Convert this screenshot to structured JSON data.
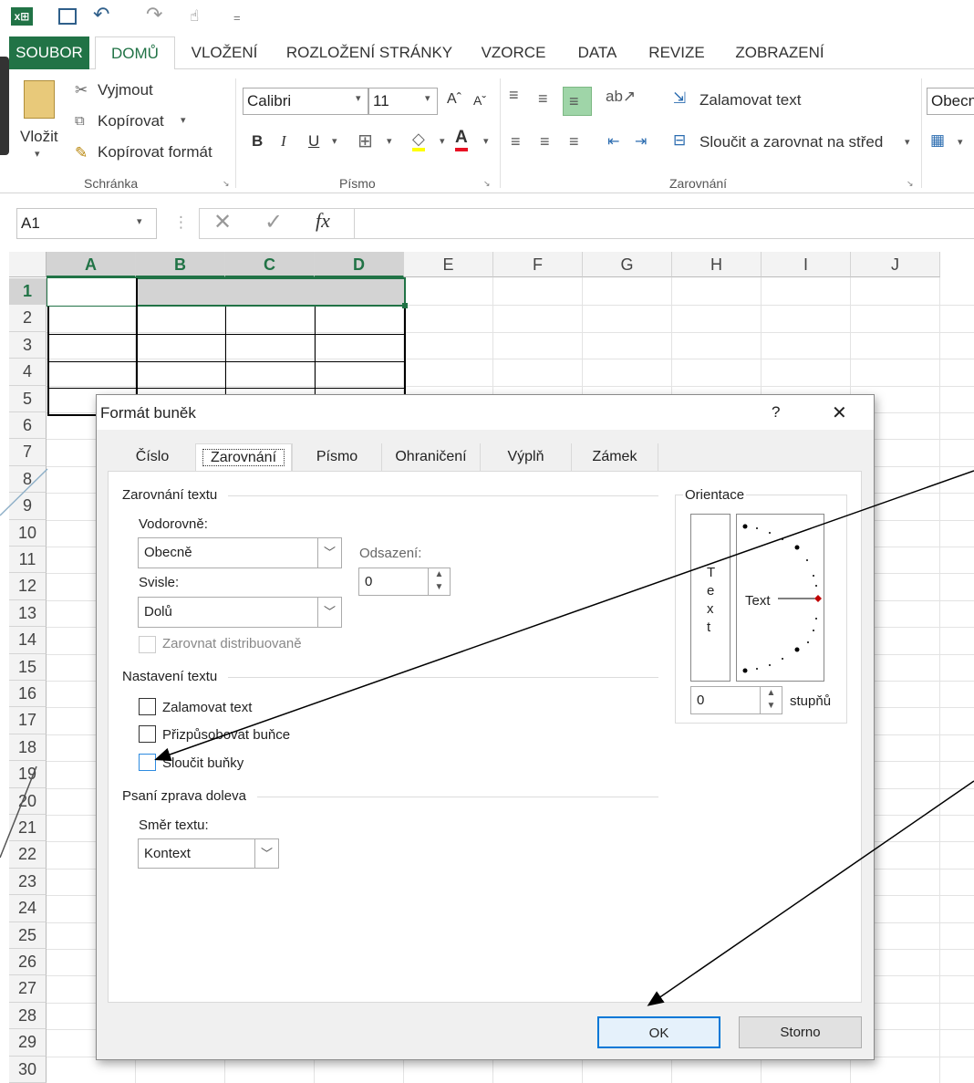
{
  "qat": {
    "undo": "↶",
    "redo": "↷",
    "customize": "="
  },
  "tabs": [
    {
      "label": "SOUBOR"
    },
    {
      "label": "DOMŮ"
    },
    {
      "label": "VLOŽENÍ"
    },
    {
      "label": "ROZLOŽENÍ STRÁNKY"
    },
    {
      "label": "VZORCE"
    },
    {
      "label": "DATA"
    },
    {
      "label": "REVIZE"
    },
    {
      "label": "ZOBRAZENÍ"
    }
  ],
  "ribbon": {
    "paste": "Vložit",
    "cut": "Vyjmout",
    "copy": "Kopírovat",
    "format_painter": "Kopírovat formát",
    "group_clipboard": "Schránka",
    "font_name": "Calibri",
    "font_size": "11",
    "bold": "B",
    "italic": "I",
    "underline": "U",
    "group_font": "Písmo",
    "wrap_text": "Zalamovat text",
    "merge_center": "Sloučit a zarovnat na střed",
    "group_alignment": "Zarovnání",
    "number_format": "Obecn"
  },
  "formula_bar": {
    "name_box": "A1",
    "fx": "fx",
    "value": ""
  },
  "sheet": {
    "columns": [
      "A",
      "B",
      "C",
      "D",
      "E",
      "F",
      "G",
      "H",
      "I",
      "J"
    ],
    "rows": [
      "1",
      "2",
      "3",
      "4",
      "5",
      "6",
      "7",
      "8",
      "9",
      "10",
      "11",
      "12",
      "13",
      "14",
      "15",
      "16",
      "17",
      "18",
      "19",
      "20",
      "21",
      "22",
      "23",
      "24",
      "25",
      "26",
      "27",
      "28",
      "29",
      "30"
    ]
  },
  "dialog": {
    "title": "Formát buněk",
    "help": "?",
    "close": "✕",
    "tabs": [
      {
        "label": "Číslo"
      },
      {
        "label": "Zarovnání"
      },
      {
        "label": "Písmo"
      },
      {
        "label": "Ohraničení"
      },
      {
        "label": "Výplň"
      },
      {
        "label": "Zámek"
      }
    ],
    "text_alignment": "Zarovnání textu",
    "horizontal_label": "Vodorovně:",
    "horizontal_value": "Obecně",
    "indent_label": "Odsazení:",
    "indent_value": "0",
    "vertical_label": "Svisle:",
    "vertical_value": "Dolů",
    "justify_distributed": "Zarovnat distribuovaně",
    "text_control": "Nastavení textu",
    "wrap": "Zalamovat text",
    "shrink": "Přizpůsobovat buňce",
    "merge": "Sloučit buňky",
    "rtl": "Psaní zprava doleva",
    "direction_label": "Směr textu:",
    "direction_value": "Kontext",
    "orientation": "Orientace",
    "orientation_vertical": "Text",
    "orientation_text": "Text",
    "degrees_value": "0",
    "degrees_label": "stupňů",
    "ok": "OK",
    "cancel": "Storno"
  },
  "colors": {
    "excel_green": "#217346",
    "ok_border": "#0078d7"
  }
}
